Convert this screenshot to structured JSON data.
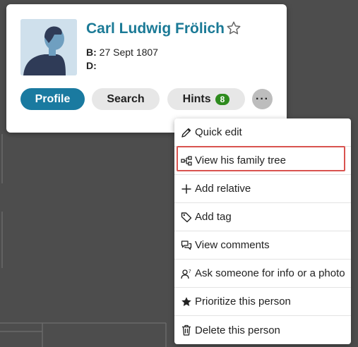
{
  "person": {
    "name": "Carl Ludwig Frölich",
    "birth_label": "B:",
    "birth_value": "27 Sept 1807",
    "death_label": "D:",
    "death_value": ""
  },
  "card": {
    "avatar_icon": "person-silhouette",
    "favorite_icon": "star-outline-icon"
  },
  "buttons": {
    "profile": "Profile",
    "search": "Search",
    "hints": "Hints",
    "hints_count": "8",
    "more": "···"
  },
  "menu": {
    "items": [
      {
        "label": "Quick edit",
        "icon": "pencil-icon"
      },
      {
        "label": "View his family tree",
        "icon": "family-tree-icon"
      },
      {
        "label": "Add relative",
        "icon": "plus-icon"
      },
      {
        "label": "Add tag",
        "icon": "tag-icon"
      },
      {
        "label": "View comments",
        "icon": "comments-icon"
      },
      {
        "label": "Ask someone for info or a photo",
        "icon": "ask-person-icon"
      },
      {
        "label": "Prioritize this person",
        "icon": "star-filled-icon"
      },
      {
        "label": "Delete this person",
        "icon": "trash-icon"
      }
    ],
    "highlighted_item": "View his family tree"
  },
  "colors": {
    "accent": "#1a7aa0",
    "name": "#1b7a96",
    "badge": "#2e8b1e",
    "highlight": "#d9534f",
    "background": "#4d4d4d"
  }
}
